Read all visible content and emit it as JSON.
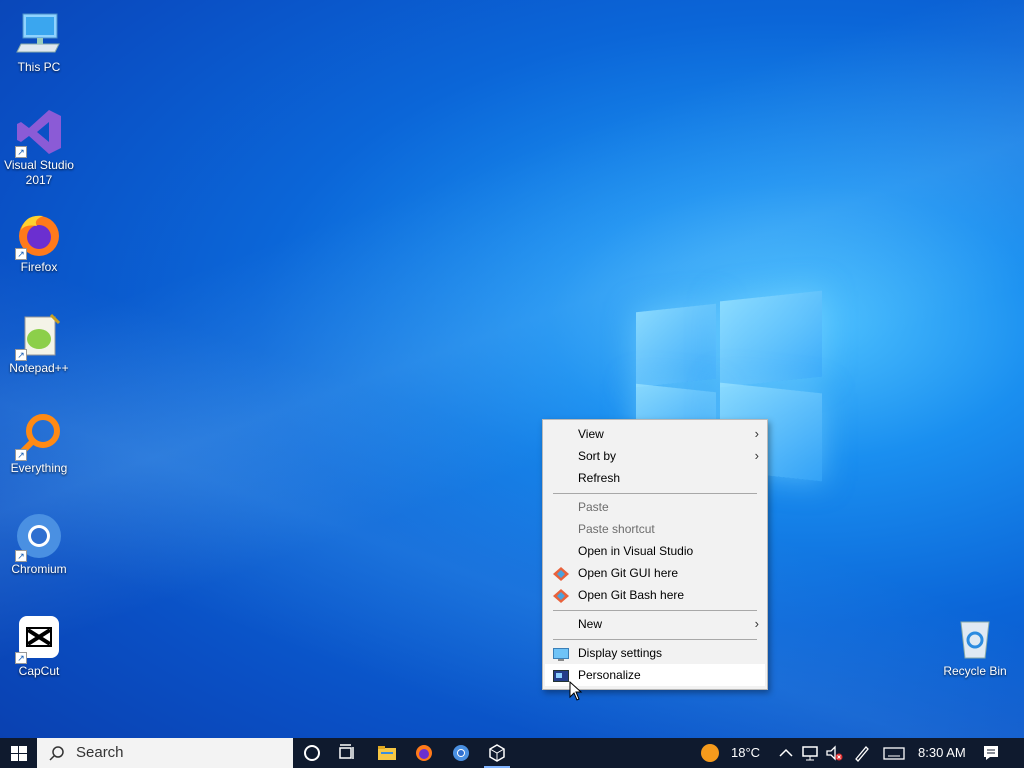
{
  "desktop_icons": [
    {
      "label": "This PC"
    },
    {
      "label": "Visual Studio 2017"
    },
    {
      "label": "Firefox"
    },
    {
      "label": "Notepad++"
    },
    {
      "label": "Everything"
    },
    {
      "label": "Chromium"
    },
    {
      "label": "CapCut"
    },
    {
      "label": "Recycle Bin"
    }
  ],
  "context_menu": {
    "view": "View",
    "sort_by": "Sort by",
    "refresh": "Refresh",
    "paste": "Paste",
    "paste_shortcut": "Paste shortcut",
    "open_vs": "Open in Visual Studio",
    "open_git_gui": "Open Git GUI here",
    "open_git_bash": "Open Git Bash here",
    "new": "New",
    "display_settings": "Display settings",
    "personalize": "Personalize",
    "submenu_arrow": "›"
  },
  "taskbar": {
    "search_label": "Search",
    "weather_temp": "18°C",
    "clock": "8:30 AM"
  },
  "colors": {
    "accent": "#0a66d8",
    "taskbar_bg": "#0f1a2e"
  }
}
